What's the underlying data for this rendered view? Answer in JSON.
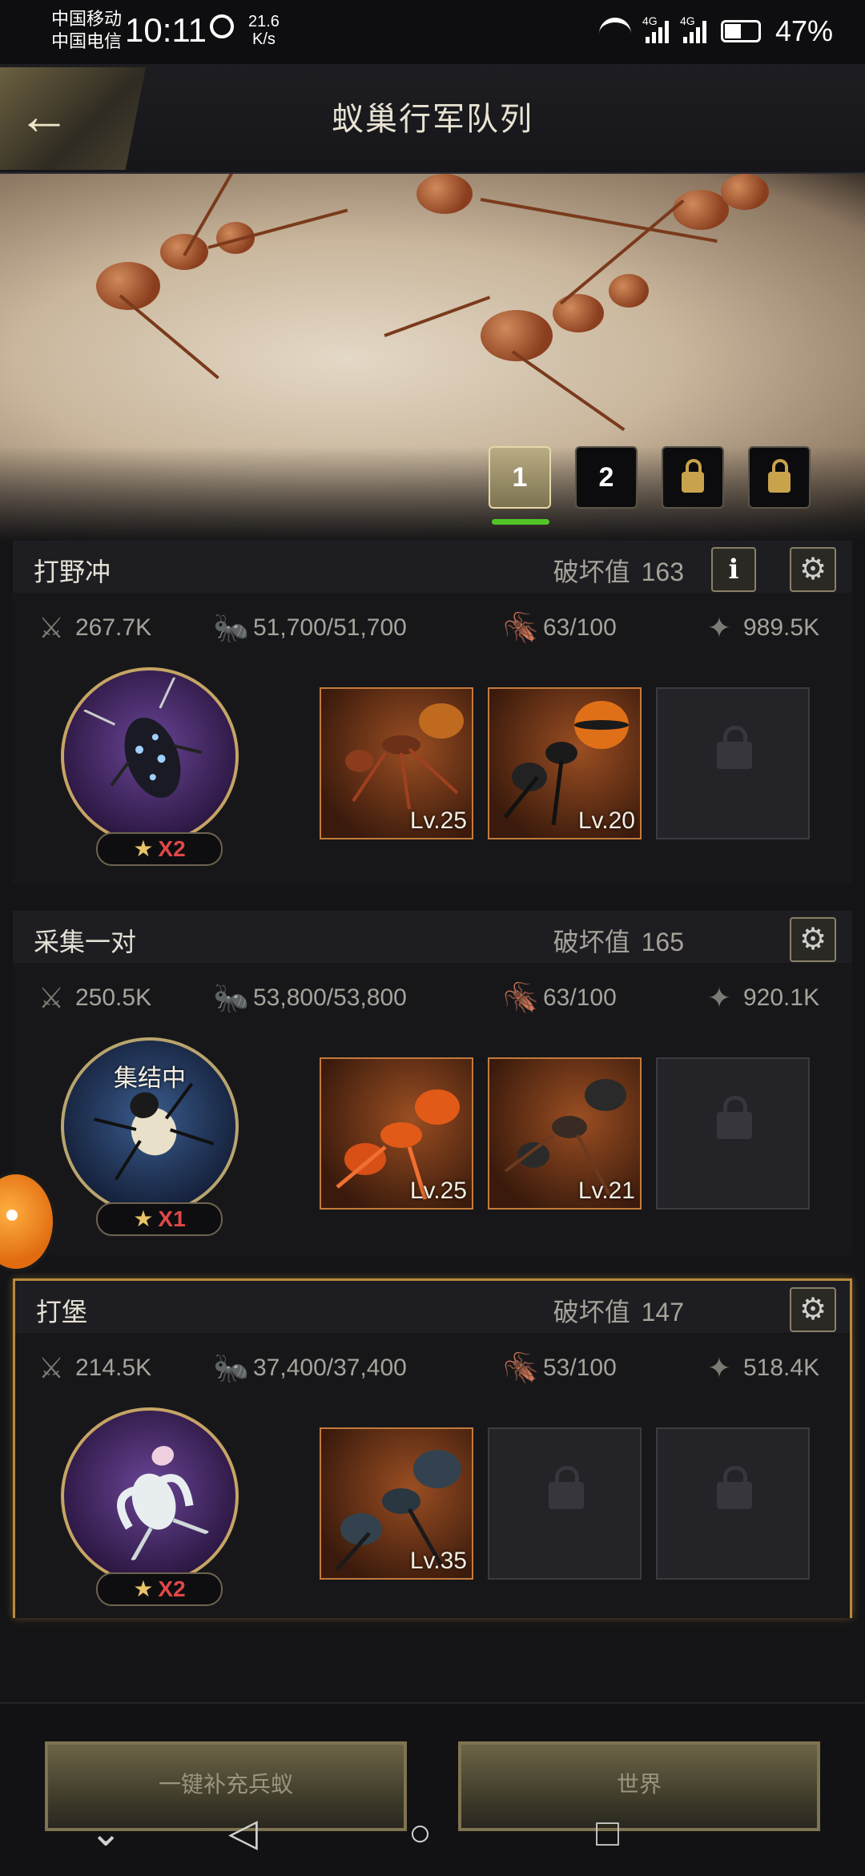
{
  "status_bar": {
    "carrier1": "中国移动",
    "carrier2": "中国电信",
    "time": "10:11",
    "speed_value": "21.6",
    "speed_unit": "K/s",
    "net1": "4G",
    "net2": "4G",
    "battery": "47%"
  },
  "header": {
    "title": "蚁巢行军队列"
  },
  "queue_tabs": [
    {
      "label": "1",
      "active": true
    },
    {
      "label": "2",
      "active": false
    },
    {
      "label": "",
      "locked": true
    },
    {
      "label": "",
      "locked": true
    }
  ],
  "queues": [
    {
      "name": "打野冲",
      "damage_label": "破坏值",
      "damage_value": "163",
      "show_info": true,
      "stats": {
        "power": "267.7K",
        "troops": "51,700/51,700",
        "load": "63/100",
        "carry": "989.5K"
      },
      "leader_stars": "X2",
      "leader_status": "",
      "slots": [
        {
          "level": "Lv.25"
        },
        {
          "level": "Lv.20"
        },
        {
          "locked": true
        }
      ]
    },
    {
      "name": "采集一对",
      "damage_label": "破坏值",
      "damage_value": "165",
      "show_info": false,
      "stats": {
        "power": "250.5K",
        "troops": "53,800/53,800",
        "load": "63/100",
        "carry": "920.1K"
      },
      "leader_stars": "X1",
      "leader_status": "集结中",
      "slots": [
        {
          "level": "Lv.25"
        },
        {
          "level": "Lv.21"
        },
        {
          "locked": true
        }
      ]
    },
    {
      "name": "打堡",
      "damage_label": "破坏值",
      "damage_value": "147",
      "show_info": false,
      "stats": {
        "power": "214.5K",
        "troops": "37,400/37,400",
        "load": "53/100",
        "carry": "518.4K"
      },
      "leader_stars": "X2",
      "leader_status": "",
      "slots": [
        {
          "level": "Lv.35"
        },
        {
          "locked": true
        },
        {
          "locked": true
        }
      ]
    }
  ],
  "buttons": {
    "refill": "一键补充兵蚁",
    "world": "世界"
  },
  "colors": {
    "accent_gold": "#c6a464",
    "active_indicator": "#52c428",
    "star_count": "#e04848"
  }
}
